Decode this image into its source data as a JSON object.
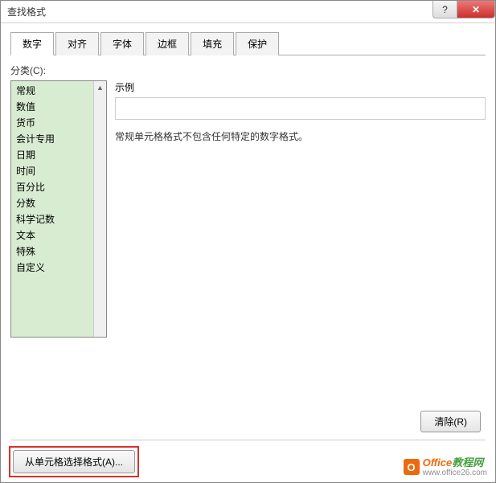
{
  "window": {
    "title": "查找格式"
  },
  "tabs": {
    "number": "数字",
    "alignment": "对齐",
    "font": "字体",
    "border": "边框",
    "fill": "填充",
    "protection": "保护"
  },
  "category": {
    "label": "分类(C):",
    "items": {
      "0": "常规",
      "1": "数值",
      "2": "货币",
      "3": "会计专用",
      "4": "日期",
      "5": "时间",
      "6": "百分比",
      "7": "分数",
      "8": "科学记数",
      "9": "文本",
      "10": "特殊",
      "11": "自定义"
    }
  },
  "sample": {
    "label": "示例"
  },
  "description": "常规单元格格式不包含任何特定的数字格式。",
  "buttons": {
    "clear": "清除(R)",
    "chooseFromCell": "从单元格选择格式(A)..."
  },
  "watermark": {
    "brand1": "Office",
    "brand2": "教程网",
    "url": "www.office26.com"
  }
}
